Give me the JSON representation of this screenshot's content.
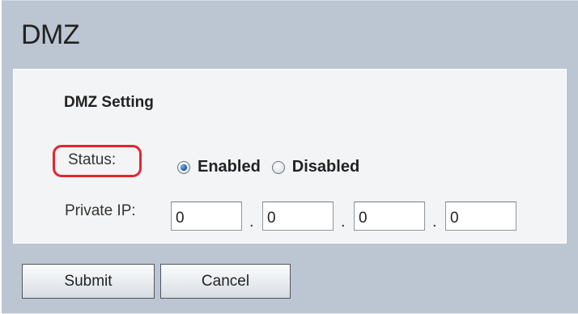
{
  "page": {
    "title": "DMZ"
  },
  "dmz_setting": {
    "heading": "DMZ Setting",
    "status_label": "Status:",
    "status_options": [
      {
        "label": "Enabled",
        "selected": true
      },
      {
        "label": "Disabled",
        "selected": false
      }
    ],
    "private_ip_label": "Private IP:",
    "private_ip_octets": [
      "0",
      "0",
      "0",
      "0"
    ],
    "octet_separator": "."
  },
  "actions": {
    "submit_label": "Submit",
    "cancel_label": "Cancel"
  },
  "colors": {
    "frame_background": "#bcc6d3",
    "panel_background": "#f3f4f5",
    "highlight_ring": "#e5252f",
    "radio_selected": "#1f5fae"
  }
}
